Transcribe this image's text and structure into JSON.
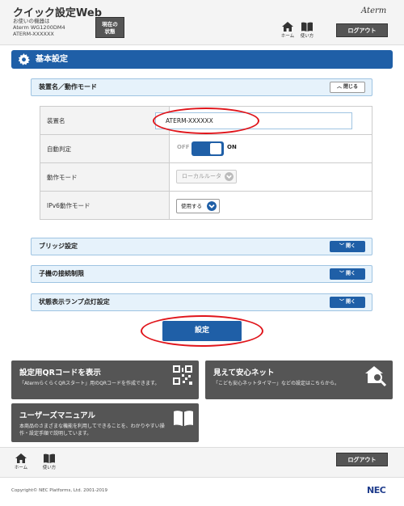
{
  "header": {
    "app_title": "クイック設定Web",
    "device_info_line1": "お使いの機器は",
    "device_info_line2": "Aterm WG1200DM4",
    "device_info_line3": "ATERM-XXXXXX",
    "status_btn_line1": "現在の",
    "status_btn_line2": "状態",
    "brand": "Aterm",
    "home_label": "ホーム",
    "manual_label": "使い方",
    "logout_label": "ログアウト"
  },
  "section_title": "基本設定",
  "panel_device": {
    "title": "装置名／動作モード",
    "toggle_label": "閉じる",
    "rows": [
      {
        "label": "装置名",
        "value": "ATERM-XXXXXX"
      },
      {
        "label": "自動判定",
        "off_text": "OFF",
        "on_text": "ON"
      },
      {
        "label": "動作モード",
        "value": "ローカルルータ"
      },
      {
        "label": "IPv6動作モード",
        "value": "使用する"
      }
    ]
  },
  "panels_collapsed": [
    {
      "title": "ブリッジ設定",
      "toggle_label": "開く"
    },
    {
      "title": "子機の接続制限",
      "toggle_label": "開く"
    },
    {
      "title": "状態表示ランプ点灯設定",
      "toggle_label": "開く"
    }
  ],
  "apply_label": "設定",
  "cards": {
    "qr": {
      "title": "設定用QRコードを表示",
      "desc": "「AtermらくらくQRスタート」用のQRコードを作成できます。"
    },
    "safe": {
      "title": "見えて安心ネット",
      "desc": "「こども安心ネットタイマー」などの設定はこちらから。"
    },
    "manual": {
      "title": "ユーザーズマニュアル",
      "desc1": "本商品のさまざまな機能を利用してできることを、わかりやすい操",
      "desc2": "作・設定手順で説明しています。"
    }
  },
  "footer": {
    "home_label": "ホーム",
    "manual_label": "使い方",
    "logout_label": "ログアウト",
    "copyright": "Copyright© NEC Platforms, Ltd. 2001-2019",
    "nec": "NEC"
  },
  "colors": {
    "accent": "#1f5fa7",
    "dark_card": "#555555",
    "highlight_red": "#e0151b"
  },
  "icons": [
    "home-icon",
    "book-icon",
    "gear-icon",
    "qr-code-icon",
    "house-search-icon",
    "chevron-up-icon",
    "chevron-down-icon"
  ]
}
